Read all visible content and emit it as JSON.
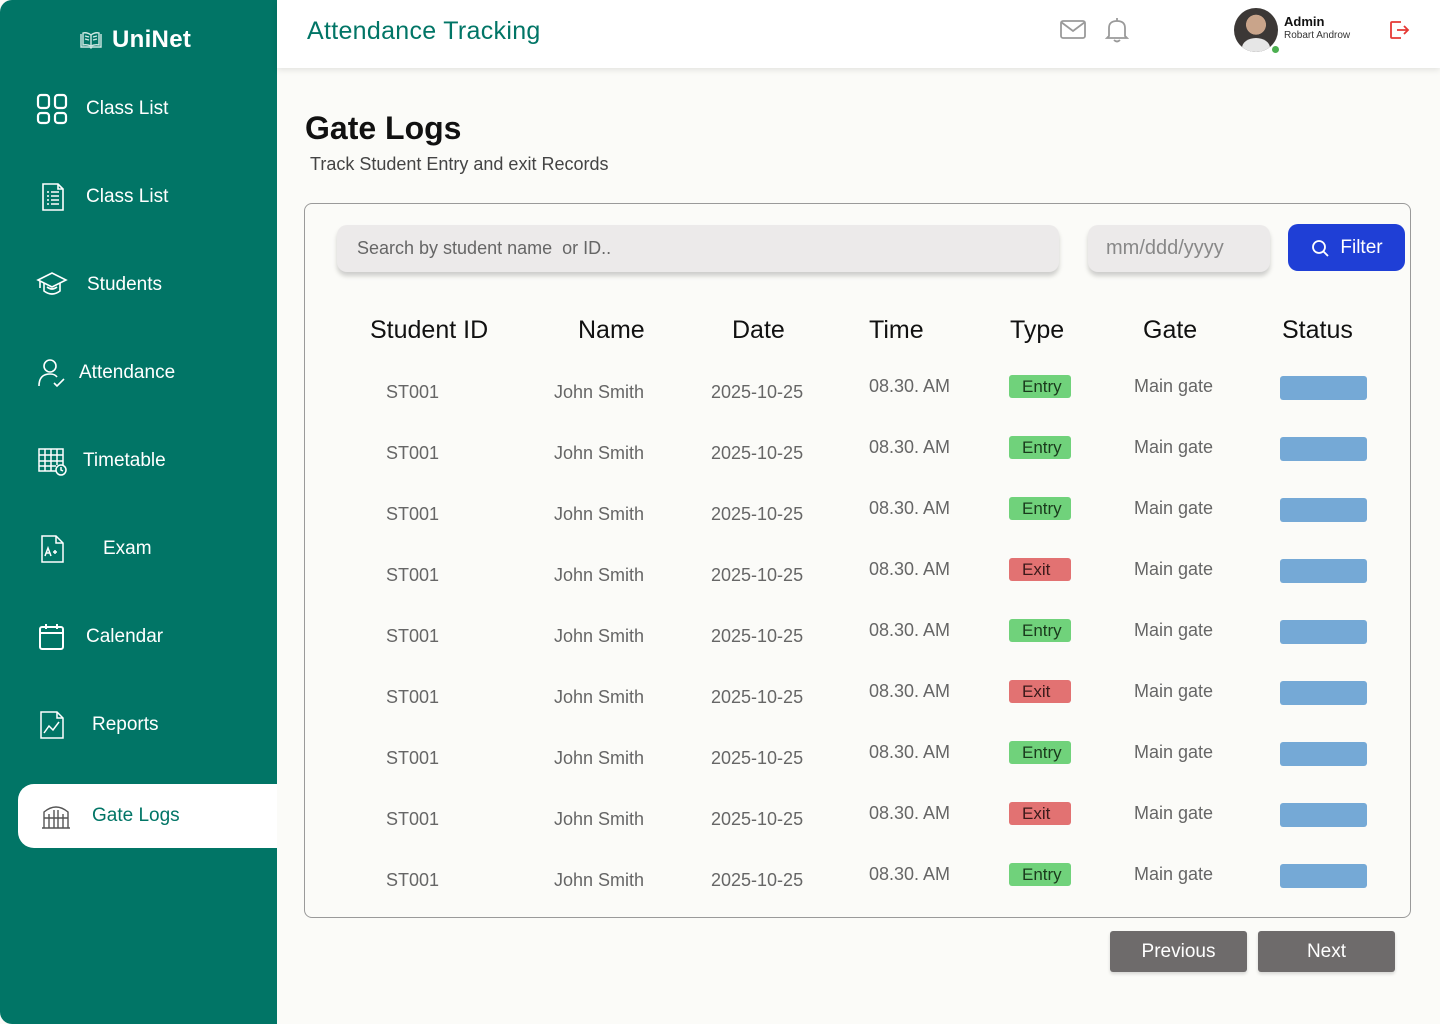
{
  "brand": {
    "name": "UniNet",
    "icon": "book-icon"
  },
  "sidebar": {
    "items": [
      {
        "label": "Class List",
        "icon": "grid-icon"
      },
      {
        "label": "Class List",
        "icon": "document-list-icon"
      },
      {
        "label": "Students",
        "icon": "graduation-cap-icon"
      },
      {
        "label": "Attendance",
        "icon": "person-check-icon"
      },
      {
        "label": "Timetable",
        "icon": "table-calendar-icon"
      },
      {
        "label": "Exam",
        "icon": "grade-paper-icon"
      },
      {
        "label": "Calendar",
        "icon": "calendar-icon"
      },
      {
        "label": "Reports",
        "icon": "chart-report-icon"
      },
      {
        "label": "Gate Logs",
        "icon": "gate-icon",
        "active": true
      }
    ]
  },
  "header": {
    "title": "Attendance Tracking",
    "user_role": "Admin",
    "user_name": "Robart Androw"
  },
  "page": {
    "title": "Gate Logs",
    "subtitle": "Track Student Entry and exit Records"
  },
  "filters": {
    "search_placeholder": "Search by student name  or ID..",
    "date_placeholder": "mm/ddd/yyyy",
    "filter_label": "Filter"
  },
  "table": {
    "headers": [
      "Student ID",
      "Name",
      "Date",
      "Time",
      "Type",
      "Gate",
      "Status"
    ],
    "rows": [
      {
        "id": "ST001",
        "name": "John Smith",
        "date": "2025-10-25",
        "time": "08.30. AM",
        "type": "Entry",
        "gate": "Main gate"
      },
      {
        "id": "ST001",
        "name": "John Smith",
        "date": "2025-10-25",
        "time": "08.30. AM",
        "type": "Entry",
        "gate": "Main gate"
      },
      {
        "id": "ST001",
        "name": "John Smith",
        "date": "2025-10-25",
        "time": "08.30. AM",
        "type": "Entry",
        "gate": "Main gate"
      },
      {
        "id": "ST001",
        "name": "John Smith",
        "date": "2025-10-25",
        "time": "08.30. AM",
        "type": "Exit",
        "gate": "Main gate"
      },
      {
        "id": "ST001",
        "name": "John Smith",
        "date": "2025-10-25",
        "time": "08.30. AM",
        "type": "Entry",
        "gate": "Main gate"
      },
      {
        "id": "ST001",
        "name": "John Smith",
        "date": "2025-10-25",
        "time": "08.30. AM",
        "type": "Exit",
        "gate": "Main gate"
      },
      {
        "id": "ST001",
        "name": "John Smith",
        "date": "2025-10-25",
        "time": "08.30. AM",
        "type": "Entry",
        "gate": "Main gate"
      },
      {
        "id": "ST001",
        "name": "John Smith",
        "date": "2025-10-25",
        "time": "08.30. AM",
        "type": "Exit",
        "gate": "Main gate"
      },
      {
        "id": "ST001",
        "name": "John Smith",
        "date": "2025-10-25",
        "time": "08.30. AM",
        "type": "Entry",
        "gate": "Main gate"
      }
    ]
  },
  "pagination": {
    "previous": "Previous",
    "next": "Next"
  },
  "colors": {
    "sidebar": "#017566",
    "primary_button": "#1f3fd6",
    "entry_badge": "#70d27b",
    "exit_badge": "#e27272",
    "status_bar": "#75a9d6",
    "pagination_button": "#6e6b6b"
  }
}
